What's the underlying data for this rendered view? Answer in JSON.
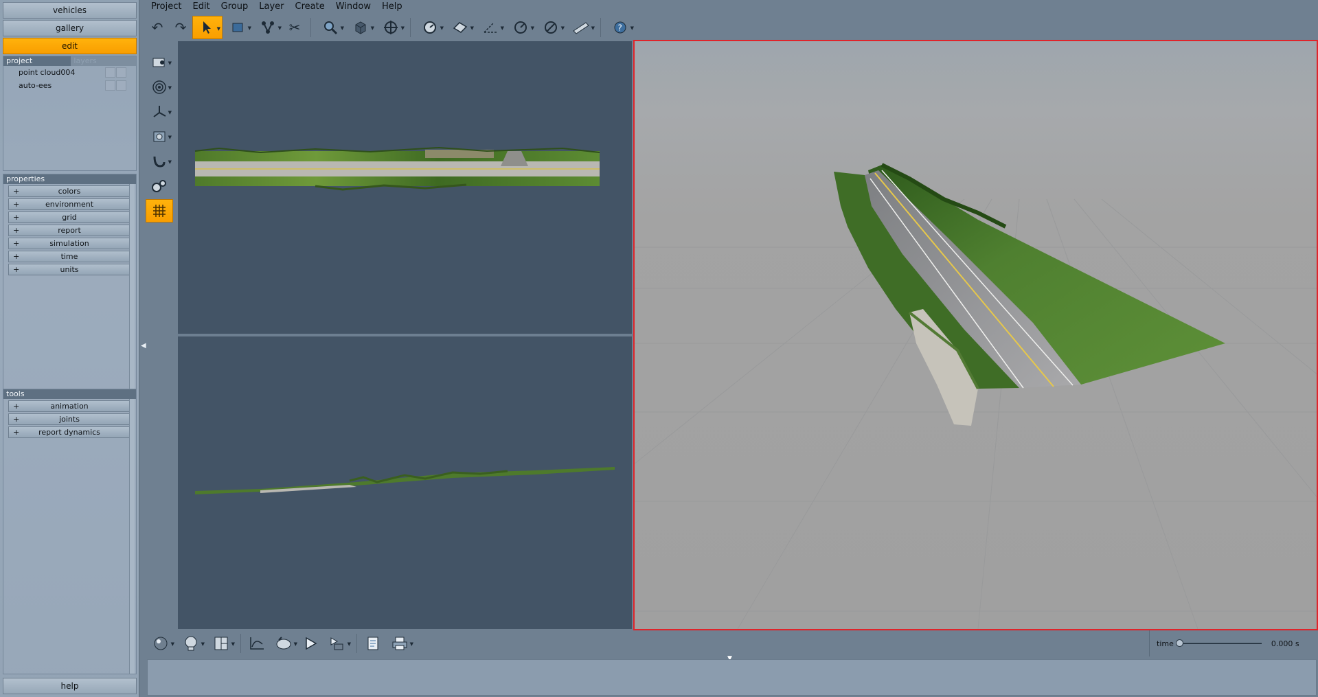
{
  "left_panel": {
    "nav": {
      "vehicles": "vehicles",
      "gallery": "gallery",
      "edit": "edit"
    },
    "project_tabs": {
      "project": "project",
      "layers": "layers"
    },
    "project_items": [
      {
        "label": "point cloud004"
      },
      {
        "label": "auto-ees"
      }
    ],
    "properties": {
      "header": "properties",
      "items": [
        {
          "plus": "+",
          "label": "colors"
        },
        {
          "plus": "+",
          "label": "environment"
        },
        {
          "plus": "+",
          "label": "grid"
        },
        {
          "plus": "+",
          "label": "report"
        },
        {
          "plus": "+",
          "label": "simulation"
        },
        {
          "plus": "+",
          "label": "time"
        },
        {
          "plus": "+",
          "label": "units"
        }
      ]
    },
    "tools": {
      "header": "tools",
      "items": [
        {
          "plus": "+",
          "label": "animation"
        },
        {
          "plus": "+",
          "label": "joints"
        },
        {
          "plus": "+",
          "label": "report dynamics"
        }
      ]
    },
    "help": "help"
  },
  "menu": [
    "Project",
    "Edit",
    "Group",
    "Layer",
    "Create",
    "Window",
    "Help"
  ],
  "toolbar": {
    "icons": [
      "undo-icon",
      "redo-icon",
      "select-arrow-icon",
      "rectangle-select-icon",
      "connect-icon",
      "delete-icon",
      "zoom-icon",
      "view-cube-icon",
      "pan-icon",
      "measure-icon",
      "plane-icon",
      "angle-icon",
      "radius-icon",
      "gauge-icon",
      "ruler-icon",
      "help-icon"
    ]
  },
  "time_control": {
    "label": "time",
    "value": "0.000 s",
    "position": 0.0
  },
  "colors": {
    "accent": "#f99e00",
    "viewport_border_active": "#e0242a",
    "ortho_viewport_bg": "#435466",
    "perspective_bg": "#a3a3a3"
  }
}
